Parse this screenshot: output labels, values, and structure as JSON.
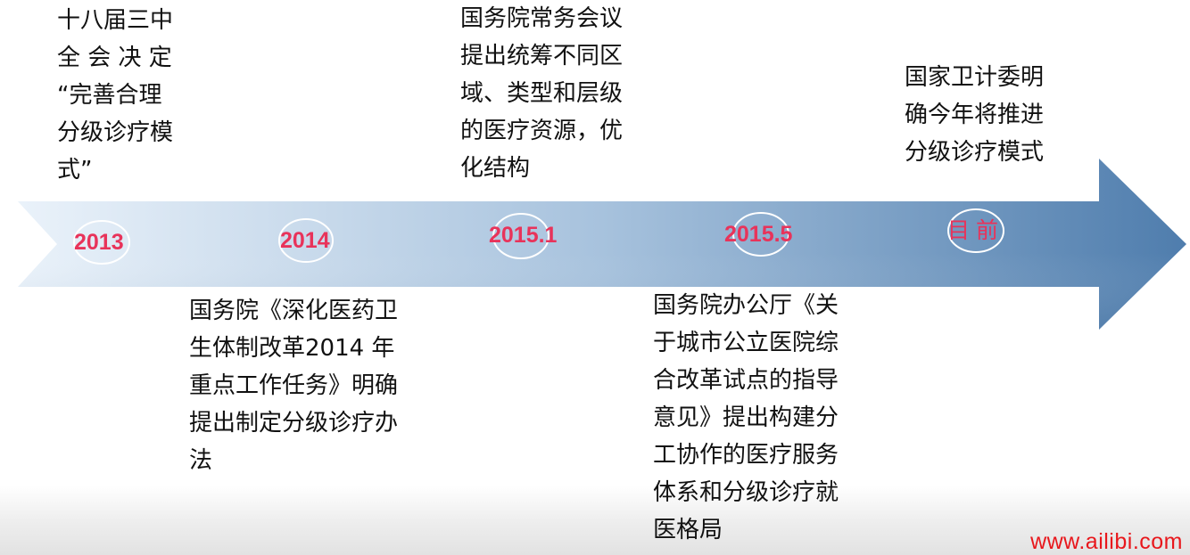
{
  "timeline": {
    "colors": {
      "arrow_light": "#eaf2fa",
      "arrow_mid": "#a7c2dd",
      "arrow_dark": "#4f7dad",
      "year_text": "#e8335a",
      "watermark": "#e8171c"
    },
    "milestones": [
      {
        "year": "2013",
        "text": "十八届三中\n全 会 决 定\n“完善合理\n分级诊疗模\n式”"
      },
      {
        "year": "2014",
        "text": "国务院《深化医药卫\n生体制改革2014 年\n重点工作任务》明确\n提出制定分级诊疗办\n法"
      },
      {
        "year": "2015.1",
        "text": "国务院常务会议\n提出统筹不同区\n域、类型和层级\n的医疗资源，优\n化结构"
      },
      {
        "year": "2015.5",
        "text": "国务院办公厅《关\n于城市公立医院综\n合改革试点的指导\n意见》提出构建分\n工协作的医疗服务\n体系和分级诊疗就\n医格局"
      },
      {
        "year": "目 前",
        "text": "国家卫计委明\n确今年将推进\n分级诊疗模式"
      }
    ]
  },
  "watermark": "www.ailibi.com"
}
